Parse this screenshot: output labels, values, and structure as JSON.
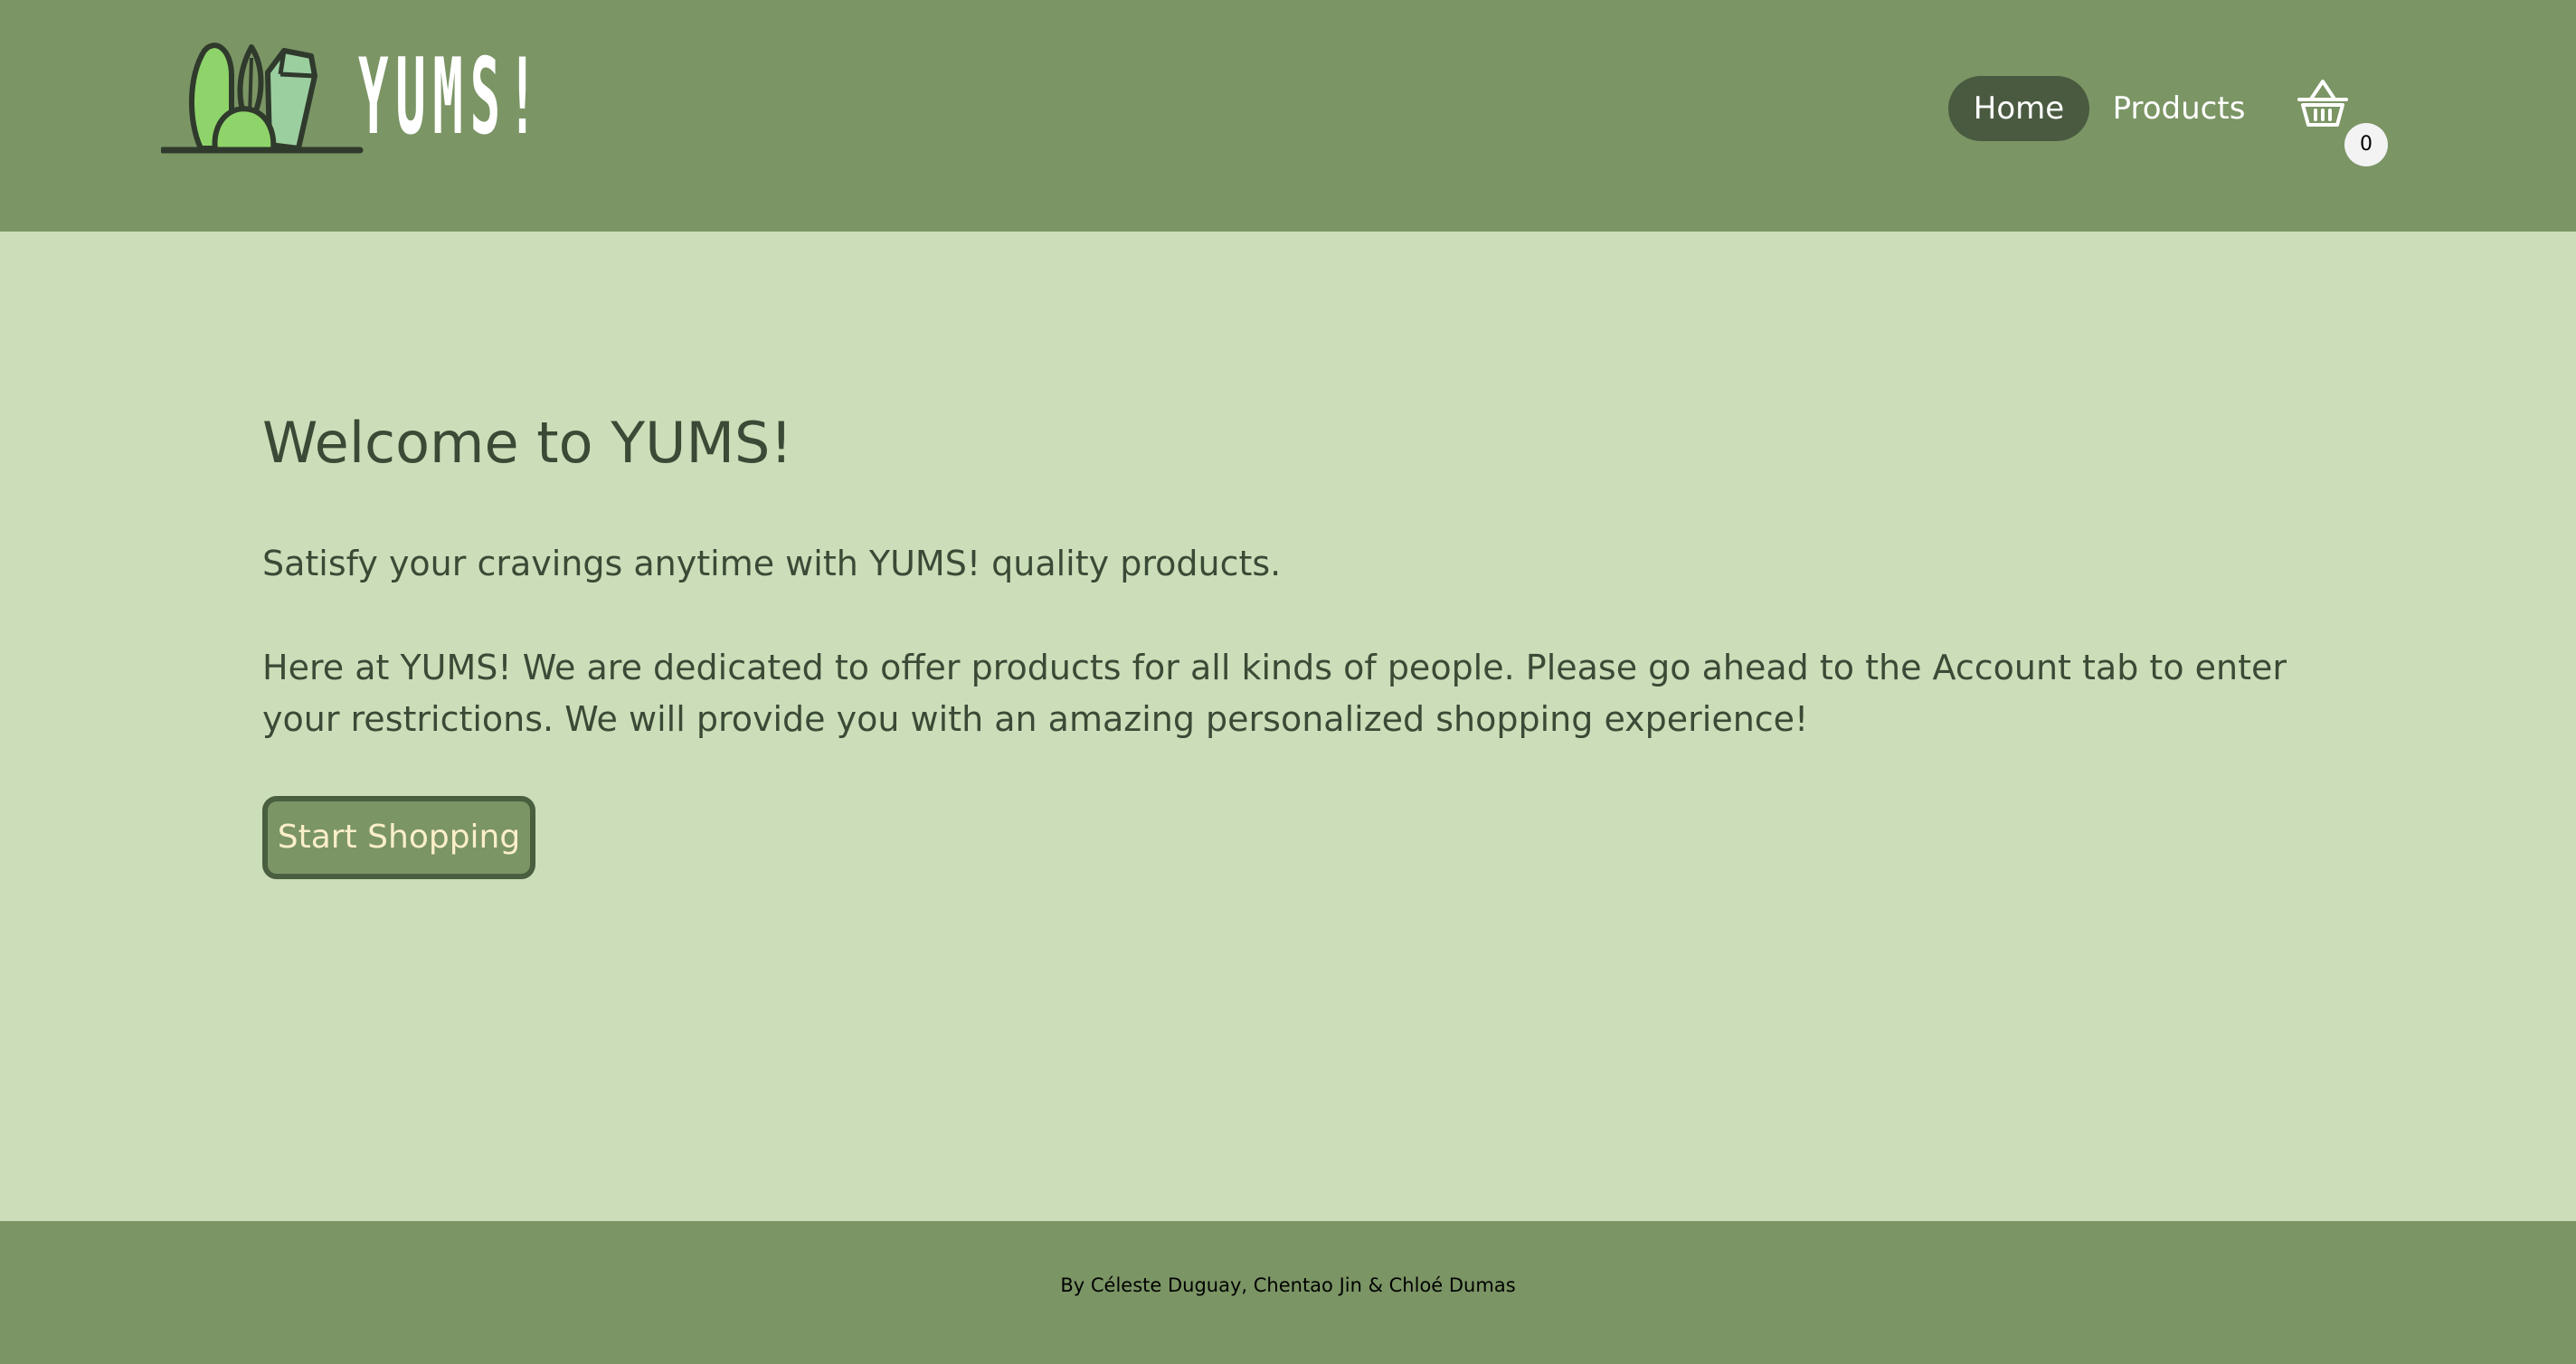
{
  "header": {
    "logo_text": "YUMS!",
    "nav": {
      "home_label": "Home",
      "products_label": "Products"
    },
    "cart": {
      "icon": "basket-icon",
      "count": "0"
    }
  },
  "main": {
    "title": "Welcome to YUMS!",
    "tagline": "Satisfy your cravings anytime with YUMS! quality products.",
    "intro": "Here at YUMS! We are dedicated to offer products for all kinds of people. Please go ahead to the Account tab to enter your restrictions. We will provide you with an amazing personalized shopping experience!",
    "cta_label": "Start Shopping"
  },
  "footer": {
    "credits": "By Céleste Duguay, Chentao Jin & Chloé Dumas"
  },
  "colors": {
    "header_bg": "#7b9565",
    "page_bg": "#ccdeb9",
    "active_nav": "#4a5a40",
    "text": "#3a4a36",
    "button_text": "#fbefc8",
    "logo_green": "#8fd46a"
  }
}
